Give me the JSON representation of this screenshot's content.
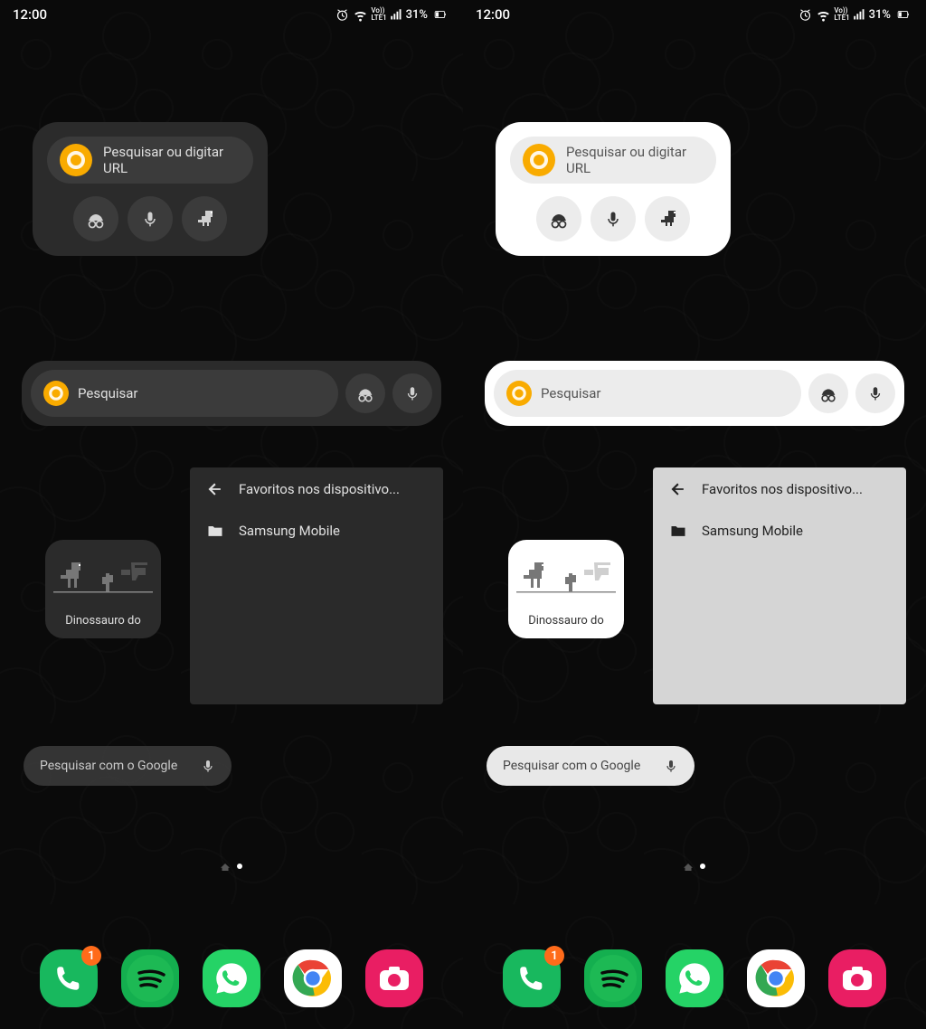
{
  "status": {
    "time": "12:00",
    "battery_pct": "31%",
    "network_label": "LTE1",
    "vo_label": "Vo))"
  },
  "chrome_widget": {
    "search_placeholder": "Pesquisar ou digitar URL"
  },
  "search_widget": {
    "placeholder": "Pesquisar"
  },
  "dino_widget": {
    "label": "Dinossauro do"
  },
  "bookmarks": {
    "title": "Favoritos nos dispositivo...",
    "items": [
      "Samsung Mobile"
    ]
  },
  "google_pill": {
    "placeholder": "Pesquisar com o Google"
  },
  "dock": {
    "phone_badge": "1"
  }
}
